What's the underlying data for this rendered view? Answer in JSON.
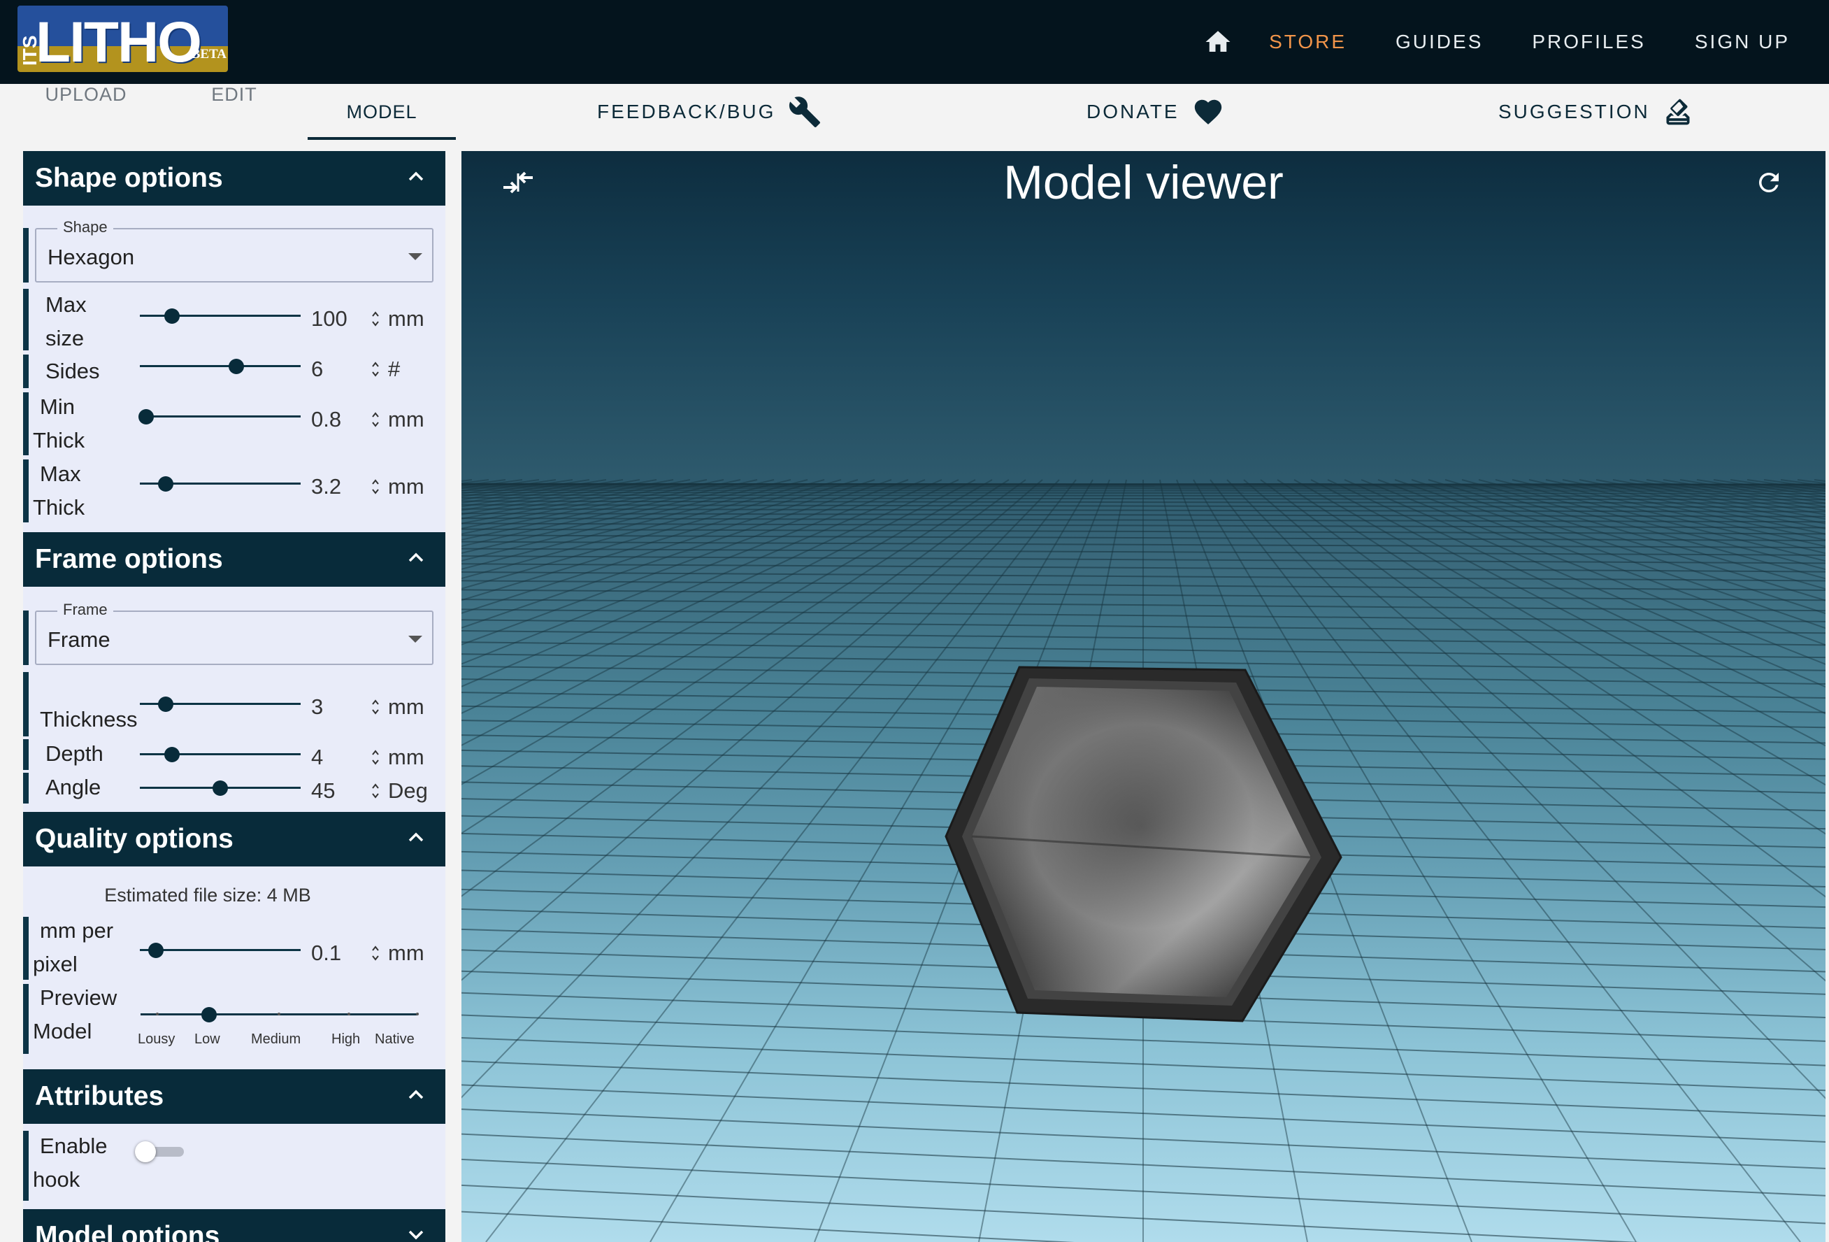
{
  "brand": {
    "its": "ITS",
    "word": "LITHO",
    "beta": "BETA"
  },
  "nav": {
    "store": "STORE",
    "guides": "GUIDES",
    "profiles": "PROFILES",
    "signup": "SIGN UP"
  },
  "tabs": {
    "upload": "UPLOAD",
    "edit": "EDIT",
    "model": "MODEL"
  },
  "actions": {
    "feedback": "FEEDBACK/BUG",
    "donate": "DONATE",
    "suggestion": "SUGGESTION"
  },
  "shape": {
    "title": "Shape options",
    "select_label": "Shape",
    "select_value": "Hexagon",
    "max_size": {
      "l1": "Max",
      "l2": "size",
      "value": "100",
      "unit": "mm",
      "fraction": 0.2
    },
    "sides": {
      "l1": "Sides",
      "value": "6",
      "unit": "#",
      "fraction": 0.6
    },
    "min_thick": {
      "l1": "Min",
      "l2": "Thick",
      "value": "0.8",
      "unit": "mm",
      "fraction": 0.04
    },
    "max_thick": {
      "l1": "Max",
      "l2": "Thick",
      "value": "3.2",
      "unit": "mm",
      "fraction": 0.16
    }
  },
  "frame": {
    "title": "Frame options",
    "select_label": "Frame",
    "select_value": "Frame",
    "thickness": {
      "l1": "Thickness",
      "value": "3",
      "unit": "mm",
      "fraction": 0.16
    },
    "depth": {
      "l1": "Depth",
      "value": "4",
      "unit": "mm",
      "fraction": 0.2
    },
    "angle": {
      "l1": "Angle",
      "value": "45",
      "unit": "Deg",
      "fraction": 0.5
    }
  },
  "quality": {
    "title": "Quality options",
    "estimate": "Estimated file size: 4 MB",
    "mm_per_pixel": {
      "l1": "mm per",
      "l2": "pixel",
      "value": "0.1",
      "unit": "mm",
      "fraction": 0.1
    },
    "preview": {
      "l1": "Preview",
      "l2": "Model",
      "levels": [
        "Lousy",
        "Low",
        "Medium",
        "High",
        "Native"
      ],
      "selected": "Low"
    }
  },
  "attributes": {
    "title": "Attributes",
    "hook": {
      "l1": "Enable",
      "l2": "hook"
    },
    "hook_enabled": false
  },
  "model_options": {
    "title": "Model options"
  },
  "viewer": {
    "title": "Model viewer"
  },
  "colors": {
    "nav_bg": "#04141d",
    "accent": "#f2954a",
    "panel_head": "#082b3a",
    "panel_bg": "#e9ecf9"
  }
}
